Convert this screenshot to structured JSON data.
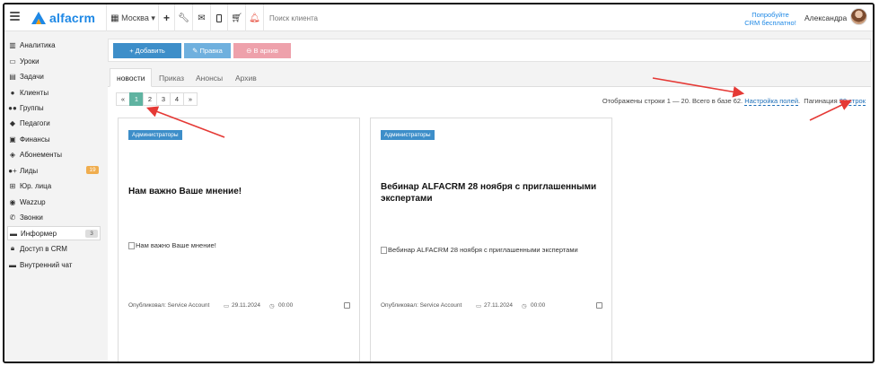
{
  "topbar": {
    "logo_text": "alfacrm",
    "city": "Москва ▾",
    "search_placeholder": "Поиск клиента",
    "promo_line1": "Попробуйте",
    "promo_line2": "CRM бесплатно!",
    "user_name": "Александра",
    "icons": [
      "menu-icon",
      "building-icon",
      "plus-icon",
      "wrench-icon",
      "mail-icon",
      "mobile-icon",
      "cart-icon",
      "bell-icon"
    ]
  },
  "sidebar": {
    "items": [
      {
        "label": "Аналитика",
        "icon": "analytics-icon"
      },
      {
        "label": "Уроки",
        "icon": "calendar-icon"
      },
      {
        "label": "Задачи",
        "icon": "tasks-icon"
      },
      {
        "label": "Клиенты",
        "icon": "user-icon"
      },
      {
        "label": "Группы",
        "icon": "users-icon"
      },
      {
        "label": "Педагоги",
        "icon": "graduation-cap-icon"
      },
      {
        "label": "Финансы",
        "icon": "money-icon"
      },
      {
        "label": "Абонементы",
        "icon": "tag-icon"
      },
      {
        "label": "Лиды",
        "icon": "user-plus-icon",
        "badge": "19"
      },
      {
        "label": "Юр. лица",
        "icon": "sitemap-icon"
      },
      {
        "label": "Wazzup",
        "icon": "whatsapp-icon"
      },
      {
        "label": "Звонки",
        "icon": "phone-icon"
      },
      {
        "label": "Информер",
        "icon": "informer-icon",
        "badge": "3"
      },
      {
        "label": "Доступ в CRM",
        "icon": "lock-icon"
      },
      {
        "label": "Внутренний чат",
        "icon": "chat-icon"
      }
    ]
  },
  "actions": {
    "add": "+ Добавить",
    "edit": "✎ Правка",
    "archive": "⊖ В архив"
  },
  "tabs": [
    {
      "label": "новости",
      "active": true
    },
    {
      "label": "Приказ"
    },
    {
      "label": "Анонсы"
    },
    {
      "label": "Архив"
    }
  ],
  "pagination": {
    "prev": "«",
    "pages": [
      "1",
      "2",
      "3",
      "4"
    ],
    "next": "»",
    "current": "1"
  },
  "rows_info": {
    "text": "Отображены строки 1 — 20. Всего в базе 62.",
    "settings_link": "Настройка полей",
    "pagination_label": "Пагинация",
    "pagination_link": "20 строк"
  },
  "cards": [
    {
      "tag": "Администраторы",
      "title": "Нам важно Ваше мнение!",
      "image_alt": "Нам важно Ваше мнение!",
      "author": "Опубликовал: Service Account",
      "date": "29.11.2024",
      "time": "00:00"
    },
    {
      "tag": "Администраторы",
      "title": "Вебинар ALFACRM 28 ноября с приглашенными экспертами",
      "image_alt": "Вебинар ALFACRM 28 ноября с приглашенными экспертами",
      "author": "Опубликовал: Service Account",
      "date": "27.11.2024",
      "time": "00:00"
    }
  ],
  "colors": {
    "primary": "#3d8ec9",
    "edit": "#6fb0de",
    "archive": "#eea1ab",
    "active_page": "#5fb3a1",
    "annotation_arrow": "#e53935",
    "badge_leads": "#f0ad4e"
  }
}
